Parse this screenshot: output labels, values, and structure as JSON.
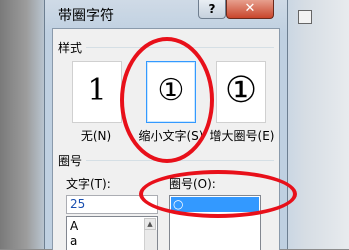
{
  "dialog": {
    "title": "带圈字符",
    "help_label": "?",
    "close_label": "✕"
  },
  "style_section": {
    "label": "样式",
    "options": [
      {
        "glyph": "1",
        "caption": "无(N)"
      },
      {
        "glyph": "①",
        "caption": "缩小文字(S)"
      },
      {
        "glyph": "①",
        "caption": "增大圈号(E)"
      }
    ]
  },
  "circle_section": {
    "label": "圈号",
    "text_label": "文字(T):",
    "text_value": "25",
    "text_list": [
      "A",
      "a"
    ],
    "circle_label": "圈号(O):",
    "circle_list": [
      "○"
    ]
  }
}
